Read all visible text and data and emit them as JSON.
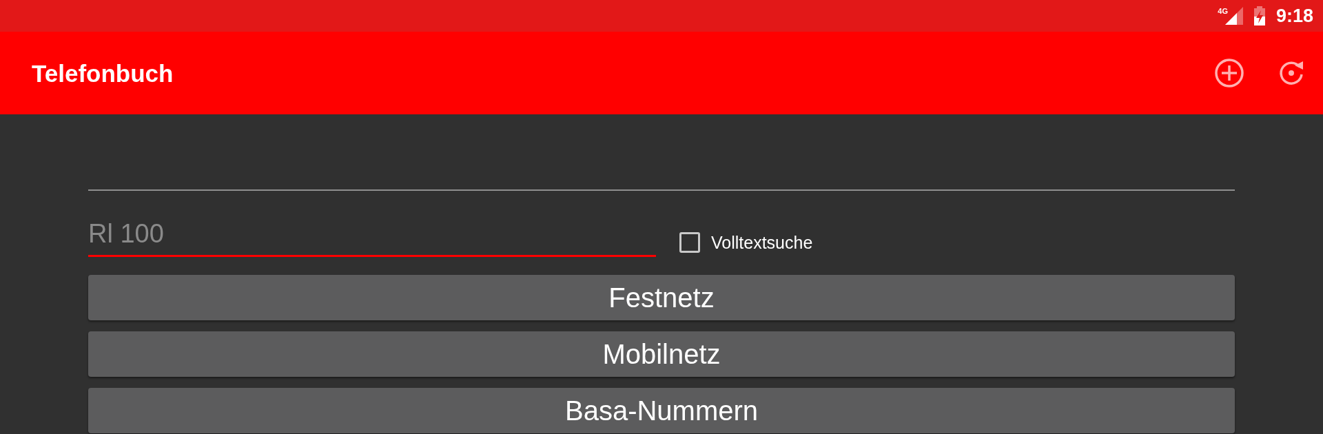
{
  "status_bar": {
    "network": "4G",
    "charging": true,
    "time": "9:18"
  },
  "app_bar": {
    "title": "Telefonbuch"
  },
  "fields": [
    {
      "focused": false
    },
    {
      "placeholder": "Rl 100",
      "focused": true
    }
  ],
  "full_text_search": {
    "label": "Volltextsuche",
    "checked": false
  },
  "buttons": [
    {
      "label": "Festnetz"
    },
    {
      "label": "Mobilnetz"
    },
    {
      "label": "Basa-Nummern"
    }
  ]
}
